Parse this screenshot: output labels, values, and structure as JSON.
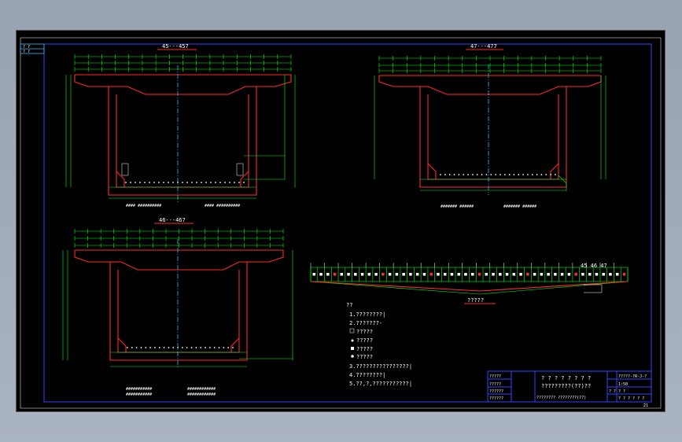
{
  "sections": [
    {
      "id": "s1",
      "title": "45---457"
    },
    {
      "id": "s2",
      "title": "47---477"
    },
    {
      "id": "s3",
      "title": "46---467"
    }
  ],
  "longitudinal": {
    "label": "?????",
    "right_tag": "45 46 47"
  },
  "notes": {
    "heading": "??",
    "lines": [
      "1.????????|",
      "2.???????-",
      "?????",
      "?????",
      "?????",
      "?????",
      "3.????????????????|",
      "4.????????|",
      "5.??,?,???????????|"
    ]
  },
  "title_block": {
    "name_line1": "? ? ? ? ? ? ? ?",
    "name_line2": "?????????(??)??",
    "name_line3": "???????? ????????(??)",
    "drawing_no": "?????-?R-J-?",
    "scale": "1:50",
    "row3_left": "? ?",
    "row3_right": "? ?",
    "row4": "? ? ? ? ? ?",
    "left_cells": [
      "?????",
      "?????",
      "??????",
      "??????"
    ]
  },
  "top_left_tag": [
    "? ?",
    "? ?"
  ],
  "sheet_number": "21"
}
